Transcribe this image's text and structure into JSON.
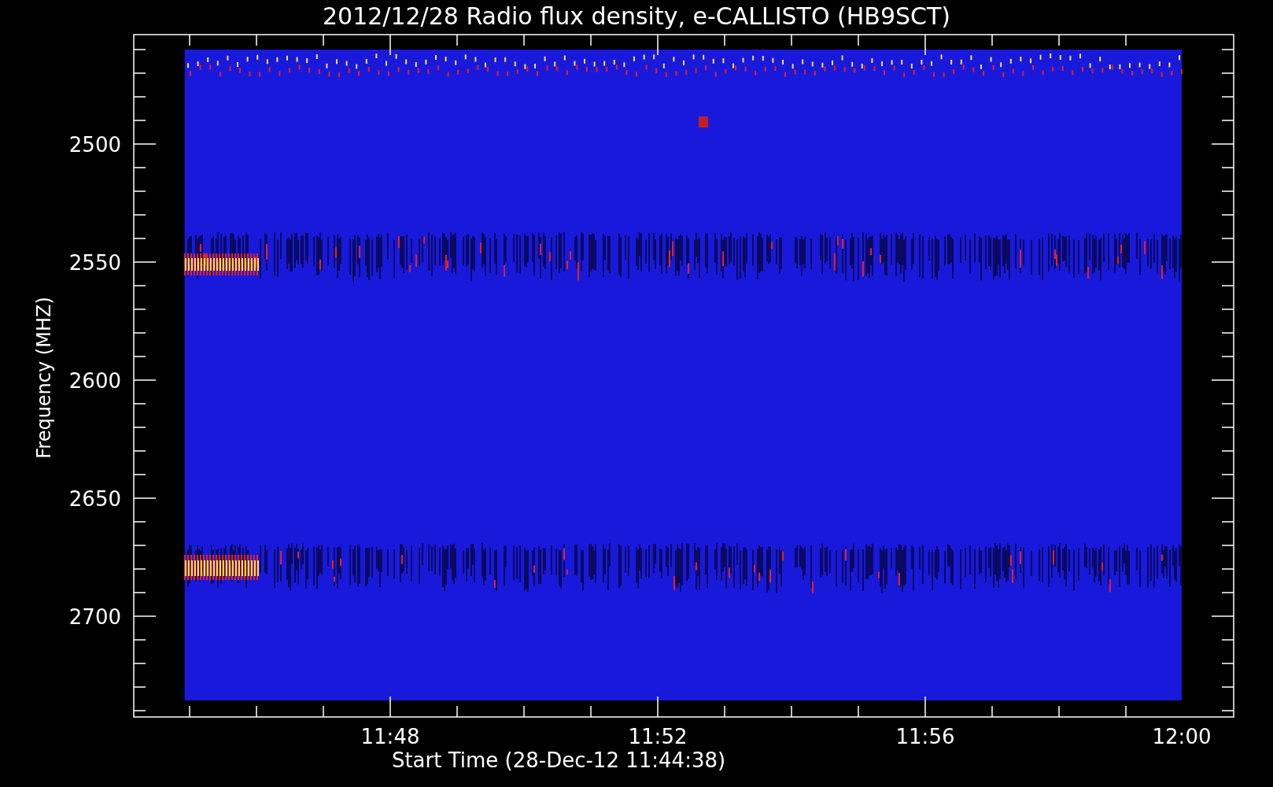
{
  "title": "2012/12/28  Radio flux density, e-CALLISTO (HB9SCT)",
  "y_axis": {
    "label": "Frequency (MHZ)",
    "ticks": [
      "2500",
      "2550",
      "2600",
      "2650",
      "2700"
    ]
  },
  "x_axis": {
    "label": "Start Time (28-Dec-12 11:44:38)",
    "ticks": [
      "11:48",
      "11:52",
      "11:56",
      "12:00"
    ]
  }
}
